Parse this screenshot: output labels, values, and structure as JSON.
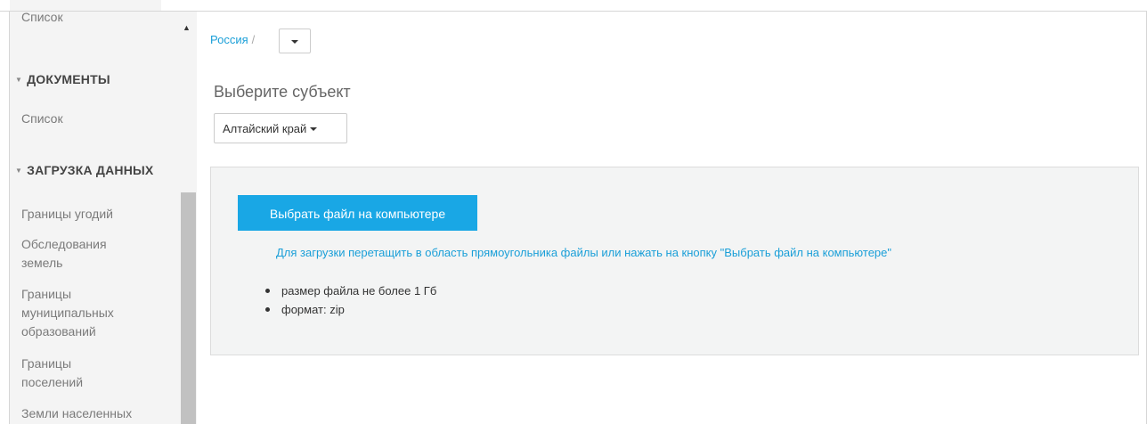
{
  "sidebar": {
    "top_cut_item": "Список",
    "sections": [
      {
        "title": "ДОКУМЕНТЫ",
        "items": [
          "Список"
        ]
      },
      {
        "title": "ЗАГРУЗКА ДАННЫХ",
        "items": [
          "Границы угодий",
          "Обследования земель",
          "Границы муниципальных образований",
          "Границы поселений",
          "Земли населенных"
        ]
      }
    ]
  },
  "breadcrumb": {
    "root": "Россия",
    "separator": "/"
  },
  "subject": {
    "label": "Выберите субъект",
    "selected": "Алтайский край"
  },
  "upload": {
    "button_label": "Выбрать файл на компьютере",
    "hint": "Для загрузки перетащить в область прямоугольника файлы или нажать на кнопку \"Выбрать файл на компьютере\"",
    "rules": [
      "размер файла не более 1 Гб",
      "формат: zip"
    ]
  },
  "colors": {
    "accent": "#19a7e5",
    "link": "#1a9fd8",
    "dropzone_bg": "#f3f4f4"
  },
  "icons": {
    "section_caret": "caret-down-icon",
    "dropdown": "chevron-down-icon",
    "scroll_up": "scroll-up-arrow-icon"
  }
}
